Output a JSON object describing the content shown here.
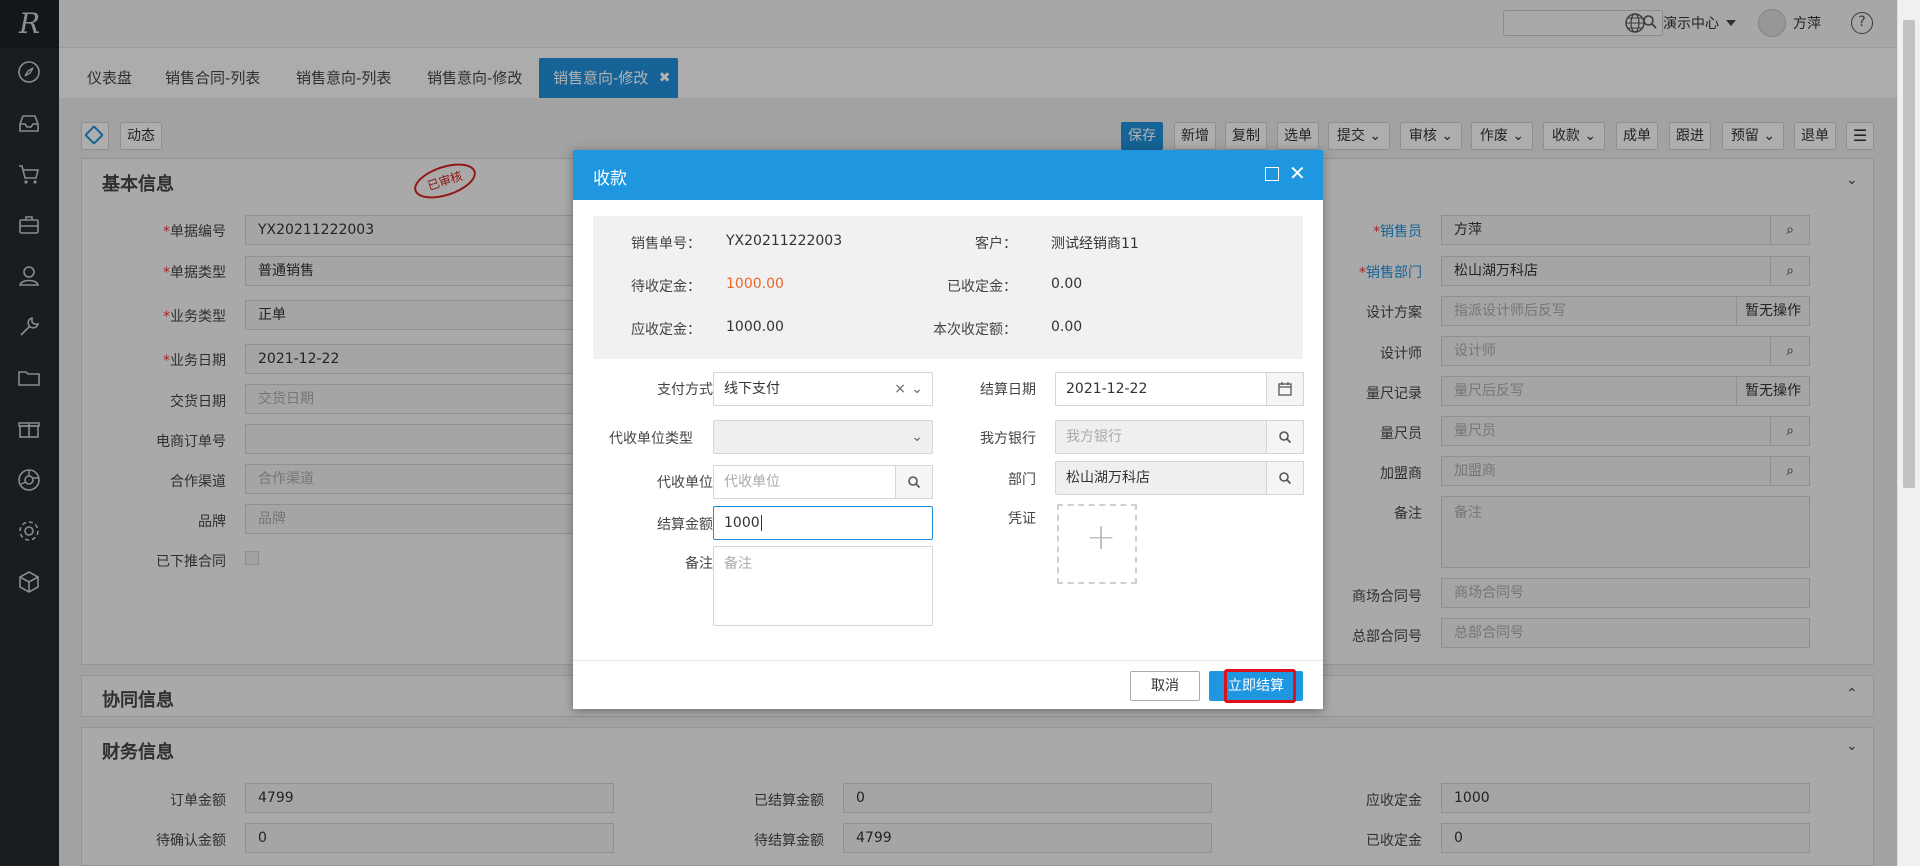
{
  "sidebar": {
    "logo": "R",
    "icons": [
      "compass-icon",
      "inbox-icon",
      "cart-icon",
      "briefcase-icon",
      "user-icon",
      "wrench-icon",
      "folder-icon",
      "gift-icon",
      "aperture-icon",
      "settings-icon",
      "cube-icon"
    ]
  },
  "topbar": {
    "org_label": "演示中心",
    "user_name": "方萍"
  },
  "tabs": [
    {
      "label": "仪表盘"
    },
    {
      "label": "销售合同-列表"
    },
    {
      "label": "销售意向-列表"
    },
    {
      "label": "销售意向-修改"
    },
    {
      "label": "销售意向-修改"
    }
  ],
  "toolbar": {
    "activity_label": "动态",
    "buttons": [
      "保存",
      "新增",
      "复制",
      "选单",
      "提交",
      "审核",
      "作废",
      "收款",
      "成单",
      "跟进",
      "预留",
      "退单"
    ]
  },
  "basic_info": {
    "title": "基本信息",
    "stamp": "已审核",
    "left_fields": [
      {
        "label": "单据编号",
        "value": "YX20211222003",
        "required": true
      },
      {
        "label": "单据类型",
        "value": "普通销售",
        "required": true
      },
      {
        "label": "业务类型",
        "value": "正单",
        "required": true
      },
      {
        "label": "业务日期",
        "value": "2021-12-22",
        "required": true
      },
      {
        "label": "交货日期",
        "placeholder": "交货日期"
      },
      {
        "label": "电商订单号",
        "value": ""
      },
      {
        "label": "合作渠道",
        "placeholder": "合作渠道"
      },
      {
        "label": "品牌",
        "placeholder": "品牌"
      },
      {
        "label": "已下推合同",
        "value": ""
      }
    ],
    "right_fields": [
      {
        "label": "销售员",
        "value": "方萍"
      },
      {
        "label": "销售部门",
        "value": "松山湖万科店"
      },
      {
        "label": "设计方案",
        "placeholder": "指派设计师后反写",
        "action": "暂无操作"
      },
      {
        "label": "设计师",
        "placeholder": "设计师"
      },
      {
        "label": "量尺记录",
        "placeholder": "量尺后反写",
        "action": "暂无操作"
      },
      {
        "label": "量尺员",
        "placeholder": "量尺员"
      },
      {
        "label": "加盟商",
        "placeholder": "加盟商"
      },
      {
        "label": "备注",
        "placeholder": "备注"
      },
      {
        "label": "商场合同号",
        "placeholder": "商场合同号"
      },
      {
        "label": "总部合同号",
        "placeholder": "总部合同号"
      }
    ]
  },
  "collab_info": {
    "title": "协同信息"
  },
  "finance_info": {
    "title": "财务信息",
    "fields": [
      {
        "label": "订单金额",
        "value": "4799"
      },
      {
        "label": "已结算金额",
        "value": "0"
      },
      {
        "label": "应收定金",
        "value": "1000"
      },
      {
        "label": "待确认金额",
        "value": "0"
      },
      {
        "label": "待结算金额",
        "value": "4799"
      },
      {
        "label": "已收定金",
        "value": "0"
      }
    ]
  },
  "modal": {
    "title": "收款",
    "info": {
      "order_no_label": "销售单号：",
      "order_no": "YX20211222003",
      "customer_label": "客户：",
      "customer": "测试经销商11",
      "pending_deposit_label": "待收定金：",
      "pending_deposit": "1000.00",
      "received_deposit_label": "已收定金：",
      "received_deposit": "0.00",
      "due_deposit_label": "应收定金：",
      "due_deposit": "1000.00",
      "current_amount_label": "本次收定额：",
      "current_amount": "0.00"
    },
    "form": {
      "pay_method_label": "支付方式",
      "pay_method": "线下支付",
      "settle_date_label": "结算日期",
      "settle_date": "2021-12-22",
      "agent_type_label": "代收单位类型",
      "our_bank_label": "我方银行",
      "our_bank_placeholder": "我方银行",
      "agent_unit_label": "代收单位",
      "agent_unit_placeholder": "代收单位",
      "dept_label": "部门",
      "dept": "松山湖万科店",
      "settle_amount_label": "结算金额",
      "settle_amount": "1000",
      "voucher_label": "凭证",
      "remark_label": "备注",
      "remark_placeholder": "备注"
    },
    "cancel_label": "取消",
    "confirm_label": "立即结算"
  },
  "colors": {
    "accent": "#1f8ed8",
    "modal_header": "#1f96e0",
    "sidebar": "#252a30",
    "highlight_red": "#e0101a",
    "amount_orange": "#e5692b"
  }
}
